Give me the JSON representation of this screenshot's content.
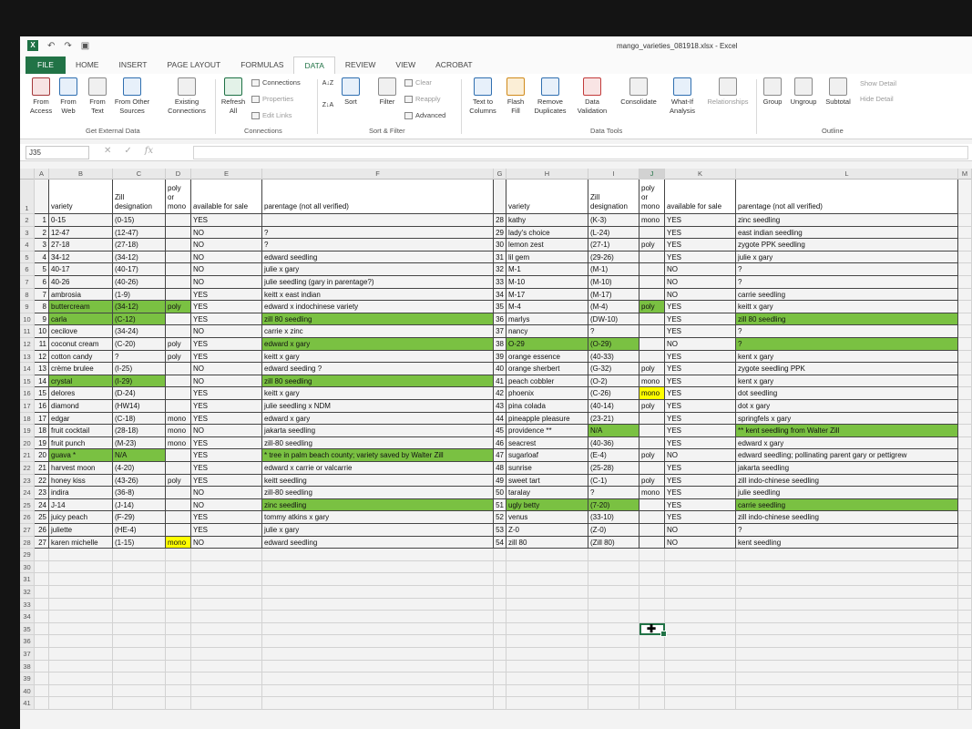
{
  "window": {
    "filename": "mango_varieties_081918.xlsx - Excel"
  },
  "tabs": [
    "FILE",
    "HOME",
    "INSERT",
    "PAGE LAYOUT",
    "FORMULAS",
    "DATA",
    "REVIEW",
    "VIEW",
    "ACROBAT"
  ],
  "ribbon": {
    "get_external": {
      "from_access": [
        "From",
        "Access"
      ],
      "from_web": [
        "From",
        "Web"
      ],
      "from_text": [
        "From",
        "Text"
      ],
      "from_other": [
        "From Other",
        "Sources"
      ],
      "existing": [
        "Existing",
        "Connections"
      ],
      "label": "Get External Data"
    },
    "connections": {
      "refresh": [
        "Refresh",
        "All"
      ],
      "connections": "Connections",
      "properties": "Properties",
      "edit_links": "Edit Links",
      "label": "Connections"
    },
    "sort_filter": {
      "sort": "Sort",
      "filter": "Filter",
      "clear": "Clear",
      "reapply": "Reapply",
      "advanced": "Advanced",
      "label": "Sort & Filter"
    },
    "data_tools": {
      "text_to_columns": [
        "Text to",
        "Columns"
      ],
      "flash_fill": [
        "Flash",
        "Fill"
      ],
      "remove_duplicates": [
        "Remove",
        "Duplicates"
      ],
      "data_validation": [
        "Data",
        "Validation"
      ],
      "consolidate": "Consolidate",
      "what_if": [
        "What-If",
        "Analysis"
      ],
      "relationships": "Relationships",
      "label": "Data Tools"
    },
    "outline": {
      "group": "Group",
      "ungroup": "Ungroup",
      "subtotal": "Subtotal",
      "show_detail": "Show Detail",
      "hide_detail": "Hide Detail",
      "label": "Outline"
    }
  },
  "formula_bar": {
    "name_box": "J35",
    "formula": ""
  },
  "columns": [
    "A",
    "B",
    "C",
    "D",
    "E",
    "F",
    "G",
    "H",
    "I",
    "J",
    "K",
    "L",
    "M"
  ],
  "header": {
    "left": {
      "b": "variety",
      "c": [
        "Zill",
        "designation"
      ],
      "d": [
        "poly",
        "or",
        "mono"
      ],
      "e": "available for sale",
      "f": "parentage (not all verified)"
    },
    "right": {
      "h": "variety",
      "i": [
        "Zill",
        "designation"
      ],
      "j": [
        "poly",
        "or",
        "mono"
      ],
      "k": "available for sale",
      "l": "parentage (not all verified)"
    }
  },
  "left_rows": [
    {
      "n": "1",
      "v": "0-15",
      "z": "(0-15)",
      "p": "",
      "a": "YES",
      "par": ""
    },
    {
      "n": "2",
      "v": "12-47",
      "z": "(12-47)",
      "p": "",
      "a": "NO",
      "par": "?"
    },
    {
      "n": "3",
      "v": "27-18",
      "z": "(27-18)",
      "p": "",
      "a": "NO",
      "par": "?"
    },
    {
      "n": "4",
      "v": "34-12",
      "z": "(34-12)",
      "p": "",
      "a": "NO",
      "par": "edward seedling"
    },
    {
      "n": "5",
      "v": "40-17",
      "z": "(40-17)",
      "p": "",
      "a": "NO",
      "par": "julie x gary"
    },
    {
      "n": "6",
      "v": "40-26",
      "z": "(40-26)",
      "p": "",
      "a": "NO",
      "par": "julie seedling (gary in parentage?)"
    },
    {
      "n": "7",
      "v": "ambrosia",
      "z": "(1-9)",
      "p": "",
      "a": "YES",
      "par": "keitt x east indian"
    },
    {
      "n": "8",
      "v": "buttercream",
      "z": "(34-12)",
      "p": "poly",
      "a": "YES",
      "par": "edward x indochinese variety"
    },
    {
      "n": "9",
      "v": "carla",
      "z": "(C-12)",
      "p": "",
      "a": "YES",
      "par": "zill 80 seedling"
    },
    {
      "n": "10",
      "v": "cecilove",
      "z": "(34-24)",
      "p": "",
      "a": "NO",
      "par": "carrie x zinc"
    },
    {
      "n": "11",
      "v": "coconut cream",
      "z": "(C-20)",
      "p": "poly",
      "a": "YES",
      "par": "edward x gary"
    },
    {
      "n": "12",
      "v": "cotton candy",
      "z": "?",
      "p": "poly",
      "a": "YES",
      "par": "keitt x gary"
    },
    {
      "n": "13",
      "v": "crème brulee",
      "z": "(I-25)",
      "p": "",
      "a": "NO",
      "par": "edward seeding ?"
    },
    {
      "n": "14",
      "v": "crystal",
      "z": "(I-29)",
      "p": "",
      "a": "NO",
      "par": "zill 80 seedling"
    },
    {
      "n": "15",
      "v": "delores",
      "z": "(D-24)",
      "p": "",
      "a": "YES",
      "par": "keitt x gary"
    },
    {
      "n": "16",
      "v": "diamond",
      "z": "(HW14)",
      "p": "",
      "a": "YES",
      "par": "julie seedling x NDM"
    },
    {
      "n": "17",
      "v": "edgar",
      "z": "(C-18)",
      "p": "mono",
      "a": "YES",
      "par": "edward x gary"
    },
    {
      "n": "18",
      "v": "fruit cocktail",
      "z": "(28-18)",
      "p": "mono",
      "a": "NO",
      "par": "jakarta seedling"
    },
    {
      "n": "19",
      "v": "fruit punch",
      "z": "(M-23)",
      "p": "mono",
      "a": "YES",
      "par": "zill-80 seedling"
    },
    {
      "n": "20",
      "v": "guava *",
      "z": "N/A",
      "p": "",
      "a": "YES",
      "par": "* tree in palm beach county; variety saved by Walter Zill"
    },
    {
      "n": "21",
      "v": "harvest moon",
      "z": "(4-20)",
      "p": "",
      "a": "YES",
      "par": "edward x carrie or valcarrie"
    },
    {
      "n": "22",
      "v": "honey kiss",
      "z": "(43-26)",
      "p": "poly",
      "a": "YES",
      "par": "keitt seedling"
    },
    {
      "n": "23",
      "v": "indira",
      "z": "(36-8)",
      "p": "",
      "a": "NO",
      "par": "zill-80 seedling"
    },
    {
      "n": "24",
      "v": "J-14",
      "z": "(J-14)",
      "p": "",
      "a": "NO",
      "par": "zinc seedling"
    },
    {
      "n": "25",
      "v": "juicy peach",
      "z": "(F-29)",
      "p": "",
      "a": "YES",
      "par": "tommy atkins x gary"
    },
    {
      "n": "26",
      "v": "juliette",
      "z": "(HE-4)",
      "p": "",
      "a": "YES",
      "par": "julie x gary"
    },
    {
      "n": "27",
      "v": "karen michelle",
      "z": "(1-15)",
      "p": "mono",
      "a": "NO",
      "par": "edward seedling"
    }
  ],
  "right_rows": [
    {
      "n": "28",
      "v": "kathy",
      "z": "(K-3)",
      "p": "mono",
      "a": "YES",
      "par": "zinc seedling"
    },
    {
      "n": "29",
      "v": "lady's choice",
      "z": "(L-24)",
      "p": "",
      "a": "YES",
      "par": "east indian seedling"
    },
    {
      "n": "30",
      "v": "lemon zest",
      "z": "(27-1)",
      "p": "poly",
      "a": "YES",
      "par": "zygote PPK seedling"
    },
    {
      "n": "31",
      "v": "lil gem",
      "z": "(29-26)",
      "p": "",
      "a": "YES",
      "par": "julie x gary"
    },
    {
      "n": "32",
      "v": "M-1",
      "z": "(M-1)",
      "p": "",
      "a": "NO",
      "par": "?"
    },
    {
      "n": "33",
      "v": "M-10",
      "z": "(M-10)",
      "p": "",
      "a": "NO",
      "par": "?"
    },
    {
      "n": "34",
      "v": "M-17",
      "z": "(M-17)",
      "p": "",
      "a": "NO",
      "par": "carrie seedling"
    },
    {
      "n": "35",
      "v": "M-4",
      "z": "(M-4)",
      "p": "poly",
      "a": "YES",
      "par": "keitt x gary"
    },
    {
      "n": "36",
      "v": "marlys",
      "z": "(DW-10)",
      "p": "",
      "a": "YES",
      "par": "zill 80 seedling"
    },
    {
      "n": "37",
      "v": "nancy",
      "z": "?",
      "p": "",
      "a": "YES",
      "par": "?"
    },
    {
      "n": "38",
      "v": "O-29",
      "z": "(O-29)",
      "p": "",
      "a": "NO",
      "par": "?"
    },
    {
      "n": "39",
      "v": "orange essence",
      "z": "(40-33)",
      "p": "",
      "a": "YES",
      "par": "kent x gary"
    },
    {
      "n": "40",
      "v": "orange sherbert",
      "z": "(G-32)",
      "p": "poly",
      "a": "YES",
      "par": "zygote seedling PPK"
    },
    {
      "n": "41",
      "v": "peach cobbler",
      "z": "(O-2)",
      "p": "mono",
      "a": "YES",
      "par": "kent x gary"
    },
    {
      "n": "42",
      "v": "phoenix",
      "z": "(C-26)",
      "p": "mono",
      "a": "YES",
      "par": "dot seedling"
    },
    {
      "n": "43",
      "v": "pina colada",
      "z": "(40-14)",
      "p": "poly",
      "a": "YES",
      "par": "dot x gary"
    },
    {
      "n": "44",
      "v": "pineapple pleasure",
      "z": "(23-21)",
      "p": "",
      "a": "YES",
      "par": "springfels x gary"
    },
    {
      "n": "45",
      "v": "providence **",
      "z": "N/A",
      "p": "",
      "a": "YES",
      "par": "** kent seedling from Walter Zill"
    },
    {
      "n": "46",
      "v": "seacrest",
      "z": "(40-36)",
      "p": "",
      "a": "YES",
      "par": "edward x gary"
    },
    {
      "n": "47",
      "v": "sugarloaf",
      "z": "(E-4)",
      "p": "poly",
      "a": "NO",
      "par": "edward seedling; pollinating parent gary or pettigrew"
    },
    {
      "n": "48",
      "v": "sunrise",
      "z": "(25-28)",
      "p": "",
      "a": "YES",
      "par": "jakarta seedling"
    },
    {
      "n": "49",
      "v": "sweet tart",
      "z": "(C-1)",
      "p": "poly",
      "a": "YES",
      "par": "zill indo-chinese seedling"
    },
    {
      "n": "50",
      "v": "taralay",
      "z": "?",
      "p": "mono",
      "a": "YES",
      "par": "julie seedling"
    },
    {
      "n": "51",
      "v": "ugly betty",
      "z": "(7-20)",
      "p": "",
      "a": "YES",
      "par": "carrie seedling"
    },
    {
      "n": "52",
      "v": "venus",
      "z": "(33-10)",
      "p": "",
      "a": "YES",
      "par": "zill indo-chinese seedling"
    },
    {
      "n": "53",
      "v": "Z-0",
      "z": "(Z-0)",
      "p": "",
      "a": "NO",
      "par": "?"
    },
    {
      "n": "54",
      "v": "zill 80",
      "z": "(Zill 80)",
      "p": "",
      "a": "NO",
      "par": "kent seedling"
    }
  ],
  "highlights": {
    "green": "#7ac142",
    "yellow": "#ffff00"
  }
}
